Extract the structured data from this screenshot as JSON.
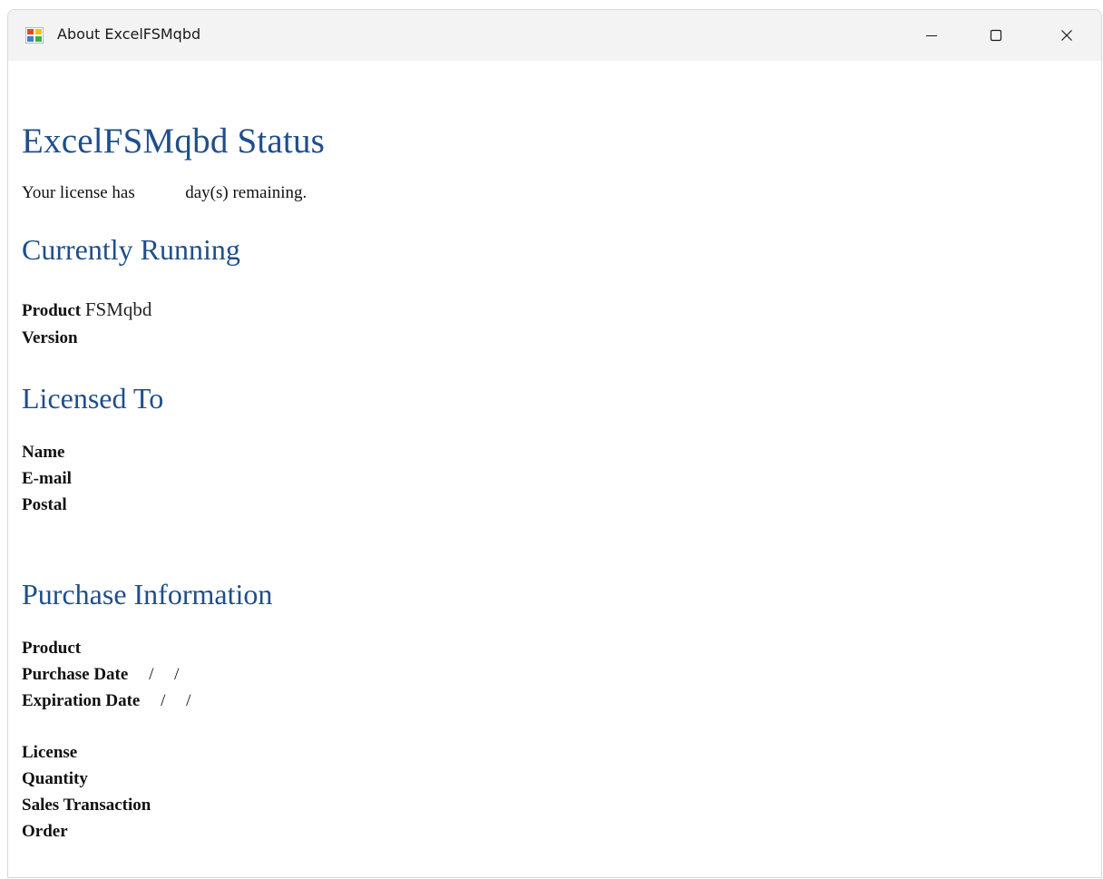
{
  "window": {
    "title": "About ExcelFSMqbd",
    "minimize_glyph": "—",
    "maximize_glyph": "☐",
    "close_glyph": "✕"
  },
  "status": {
    "heading": "ExcelFSMqbd Status",
    "license_prefix": "Your license has",
    "license_days": "",
    "license_suffix": "day(s) remaining."
  },
  "currently_running": {
    "heading": "Currently Running",
    "product_label": "Product",
    "product_value": "FSMqbd",
    "version_label": "Version",
    "version_value": ""
  },
  "licensed_to": {
    "heading": "Licensed To",
    "name_label": "Name",
    "email_label": "E-mail",
    "postal_label": "Postal"
  },
  "purchase": {
    "heading": "Purchase Information",
    "product_label": "Product",
    "purchase_date_label": "Purchase Date",
    "purchase_date_value": "/ /",
    "expiration_date_label": "Expiration Date",
    "expiration_date_value": "/ /",
    "license_label": "License",
    "quantity_label": "Quantity",
    "sales_transaction_label": "Sales Transaction",
    "order_label": "Order"
  }
}
